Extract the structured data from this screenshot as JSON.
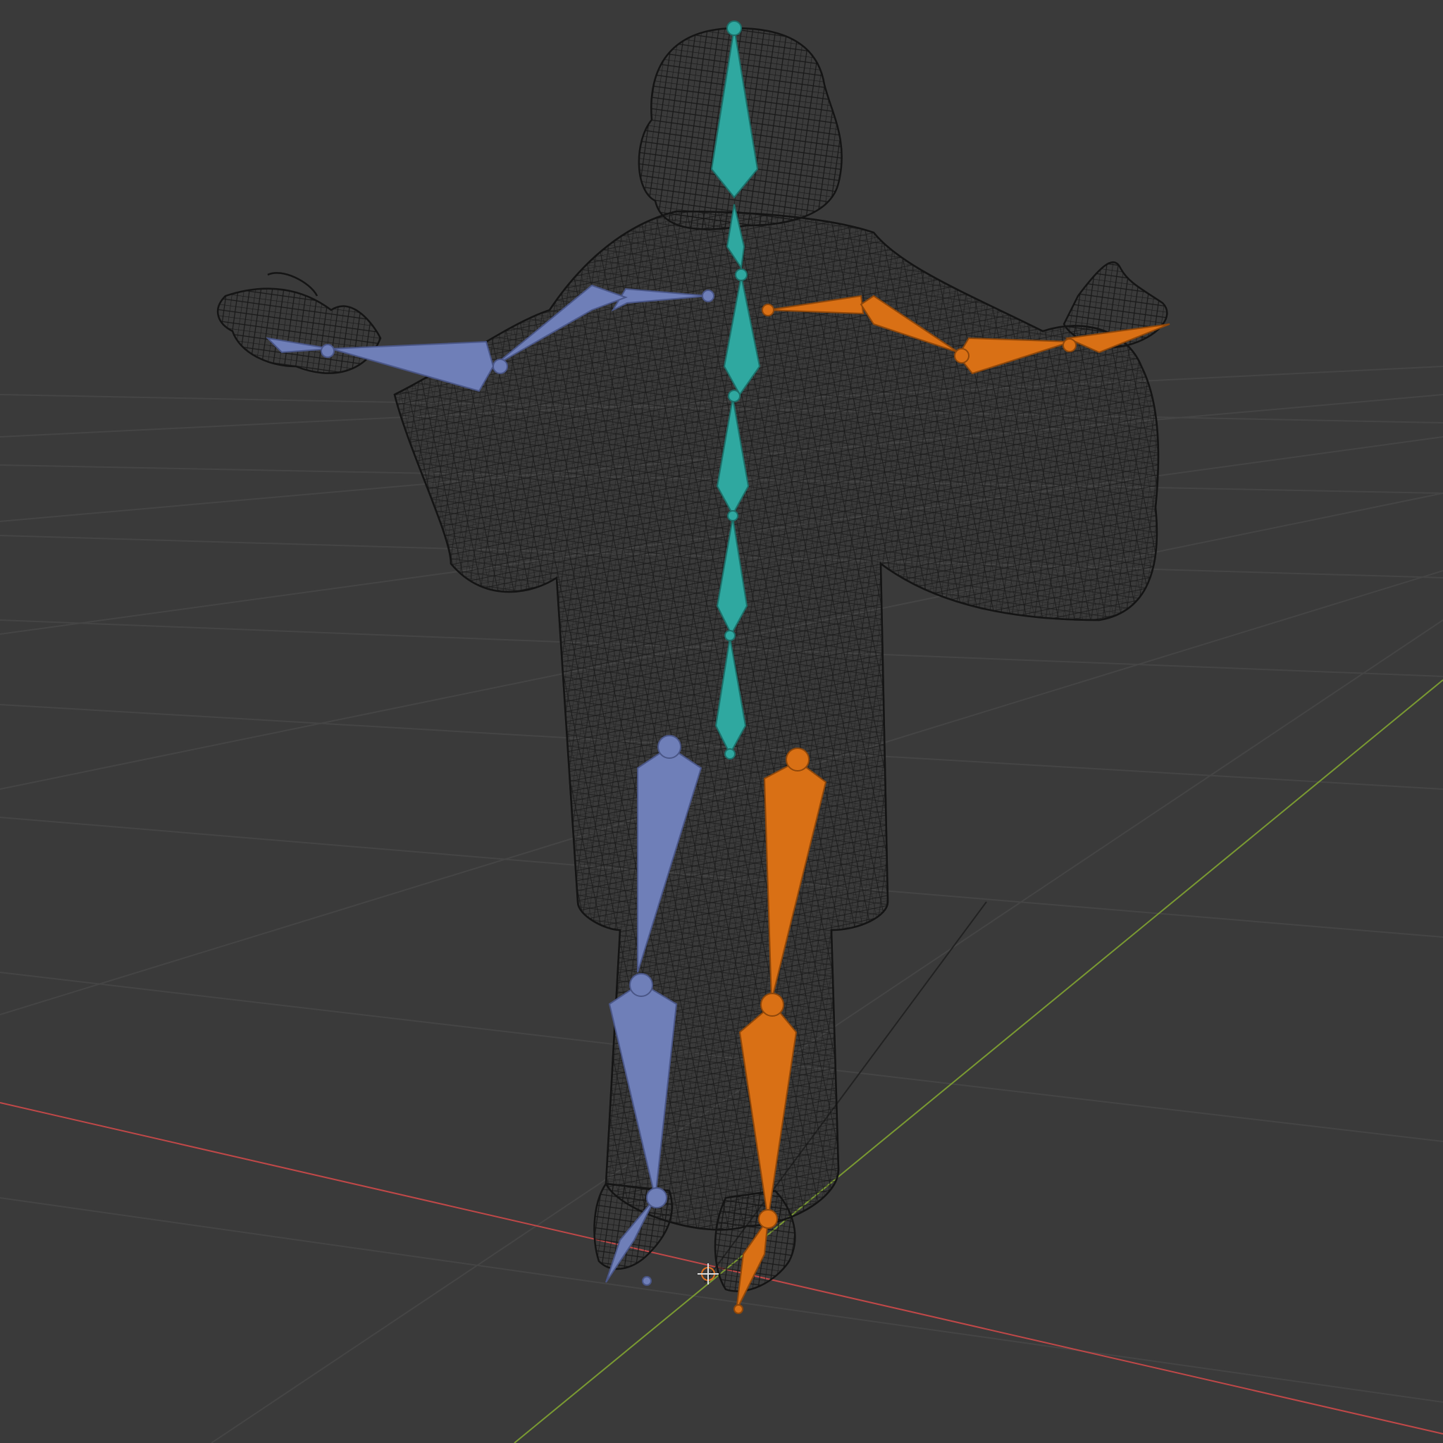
{
  "viewport": {
    "background": "#3a3a3a",
    "grid_color": "#454545",
    "axis_x_color": "#c04848",
    "axis_y_color": "#7a9a32",
    "mesh_color": "#141414",
    "bone_colors": {
      "spine": "#2fa8a0",
      "left": "#6f7fb8",
      "right": "#d97015"
    },
    "mode": "wireframe",
    "objects": [
      "grid-floor",
      "origin-cursor",
      "character-mesh",
      "armature"
    ]
  }
}
